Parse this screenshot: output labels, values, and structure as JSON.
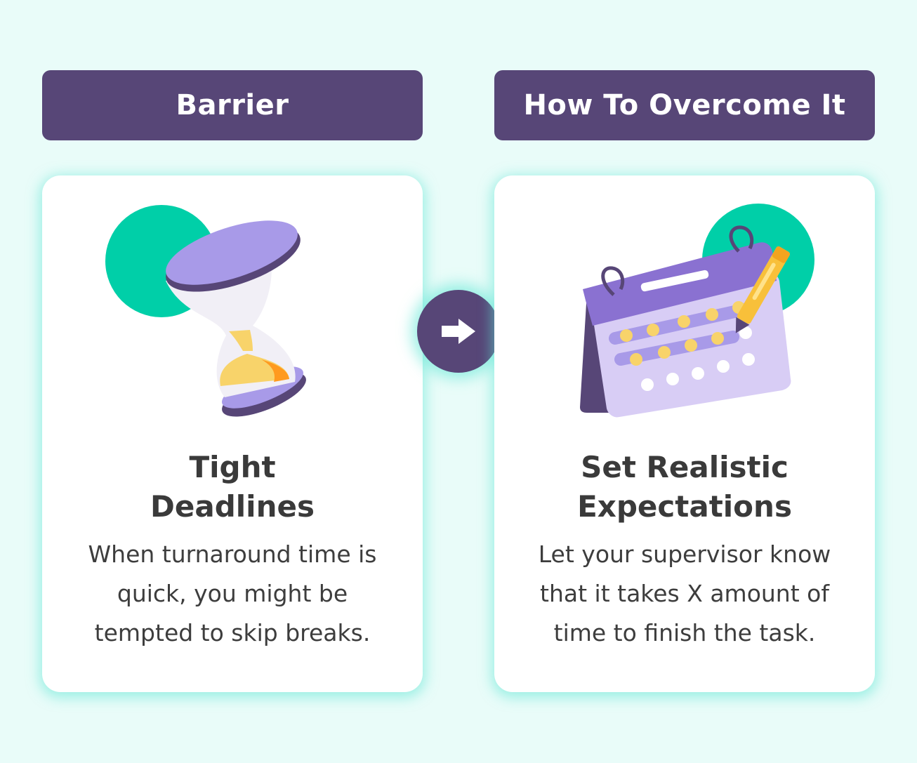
{
  "columns": {
    "barrier": {
      "header": "Barrier",
      "title_line1": "Tight",
      "title_line2": "Deadlines",
      "body_line1": "When turnaround time is",
      "body_line2": "quick, you might be",
      "body_line3": "tempted to skip breaks.",
      "icon": "hourglass-icon"
    },
    "overcome": {
      "header": "How To Overcome It",
      "title_line1": "Set Realistic",
      "title_line2": "Expectations",
      "body_line1": "Let your supervisor know",
      "body_line2": "that it takes X amount of",
      "body_line3": "time to finish the task.",
      "icon": "calendar-icon"
    }
  },
  "connector_icon": "arrow-right-icon",
  "colors": {
    "background": "#e9fcf9",
    "header": "#574677",
    "accent_green": "#00cfa8",
    "accent_purple": "#a89ae8",
    "accent_yellow": "#f8d36a",
    "card_glow": "#5ce6d4"
  }
}
